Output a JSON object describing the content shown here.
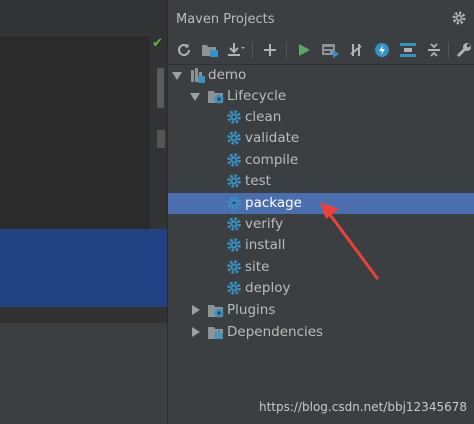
{
  "panel": {
    "title": "Maven Projects"
  },
  "toolbar": {
    "buttons": [
      {
        "icon": "refresh-icon"
      },
      {
        "icon": "generate-sources-icon"
      },
      {
        "icon": "download-icon"
      },
      {
        "icon": "add-icon"
      },
      {
        "icon": "run-icon"
      },
      {
        "icon": "run-configuration-icon"
      },
      {
        "icon": "toggle-offline-icon"
      },
      {
        "icon": "skip-tests-icon"
      },
      {
        "icon": "show-dependencies-icon"
      },
      {
        "icon": "collapse-all-icon"
      },
      {
        "icon": "settings-wrench-icon"
      }
    ]
  },
  "tree": {
    "project": "demo",
    "lifecycle": {
      "label": "Lifecycle",
      "items": [
        "clean",
        "validate",
        "compile",
        "test",
        "package",
        "verify",
        "install",
        "site",
        "deploy"
      ],
      "selected": "package"
    },
    "plugins": "Plugins",
    "dependencies": "Dependencies"
  },
  "watermark": "https://blog.csdn.net/bbj12345678",
  "colors": {
    "selection": "#4b6eaf",
    "editor_selection": "#214283",
    "annotation_arrow": "#e8423b",
    "gear_blue": "#3592c4",
    "run_green": "#59a869"
  }
}
